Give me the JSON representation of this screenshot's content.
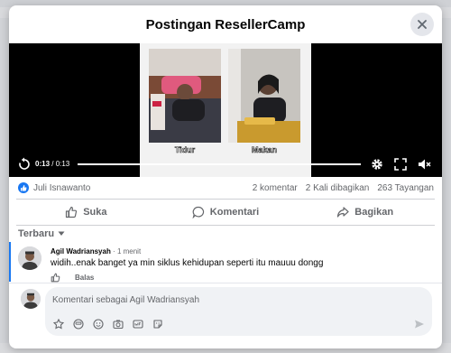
{
  "modal": {
    "title": "Postingan ResellerCamp"
  },
  "video": {
    "caption_left": "Tidur",
    "caption_right": "Makan",
    "time_current": "0:13",
    "time_separator": " / ",
    "time_total": "0:13",
    "progress": 1.0
  },
  "stats": {
    "reactor": "Juli Isnawanto",
    "comments": "2 komentar",
    "shares": "2 Kali dibagikan",
    "views": "263 Tayangan"
  },
  "actions": {
    "like": "Suka",
    "comment": "Komentari",
    "share": "Bagikan"
  },
  "sort": {
    "label": "Terbaru"
  },
  "comment": {
    "author": "Agil Wadriansyah",
    "separator": " · ",
    "time": "1 menit",
    "text": "widih..enak banget ya min siklus kehidupan seperti itu mauuu dongg",
    "reply": "Balas"
  },
  "composer": {
    "placeholder": "Komentari sebagai Agil Wadriansyah"
  },
  "colors": {
    "accent": "#1877f2",
    "text": "#050505",
    "muted": "#65676b",
    "composer_bg": "#f0f2f5"
  },
  "icons": [
    "close-icon",
    "replay-icon",
    "settings-icon",
    "fullscreen-icon",
    "mute-icon",
    "like-icon",
    "comment-icon",
    "share-icon",
    "chevron-down-icon",
    "sticker-icon",
    "emoji-icon",
    "camera-icon",
    "gif-icon",
    "send-icon"
  ]
}
